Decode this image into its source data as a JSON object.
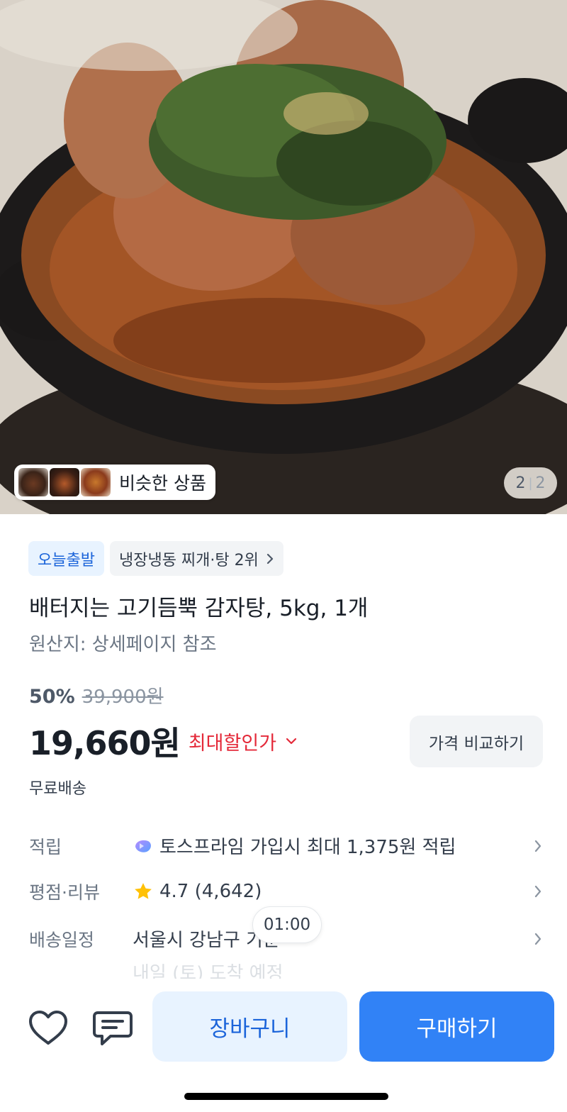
{
  "hero": {
    "similar_label": "비슷한 상품",
    "page_current": "2",
    "page_total": "2"
  },
  "badges": {
    "today_ship": "오늘출발",
    "ranking": "냉장냉동 찌개·탕 2위"
  },
  "product": {
    "title": "배터지는 고기듬뿍 감자탕, 5kg, 1개",
    "origin": "원산지: 상세페이지 참조",
    "discount_rate": "50%",
    "original_price": "39,900원",
    "price": "19,660원",
    "best_price_label": "최대할인가",
    "compare_label": "가격 비교하기",
    "shipping": "무료배송"
  },
  "info": {
    "points_label": "적립",
    "points_value": "토스프라임 가입시 최대 1,375원 적립",
    "rating_label": "평점·리뷰",
    "rating_value": "4.7 (4,642)",
    "delivery_label": "배송일정",
    "delivery_value": "서울시 강남구 기준",
    "delivery_sub": "내일 (토) 도착 예정"
  },
  "time_bubble": "01:00",
  "bottom": {
    "cart_label": "장바구니",
    "buy_label": "구매하기"
  },
  "colors": {
    "primary": "#3182f6",
    "primary_light": "#e8f3ff",
    "discount_red": "#e42939",
    "star": "#ffc107"
  },
  "icons": [
    "heart-icon",
    "chat-icon",
    "chevron-right-icon",
    "chevron-down-icon",
    "star-icon",
    "toss-prime-icon"
  ]
}
